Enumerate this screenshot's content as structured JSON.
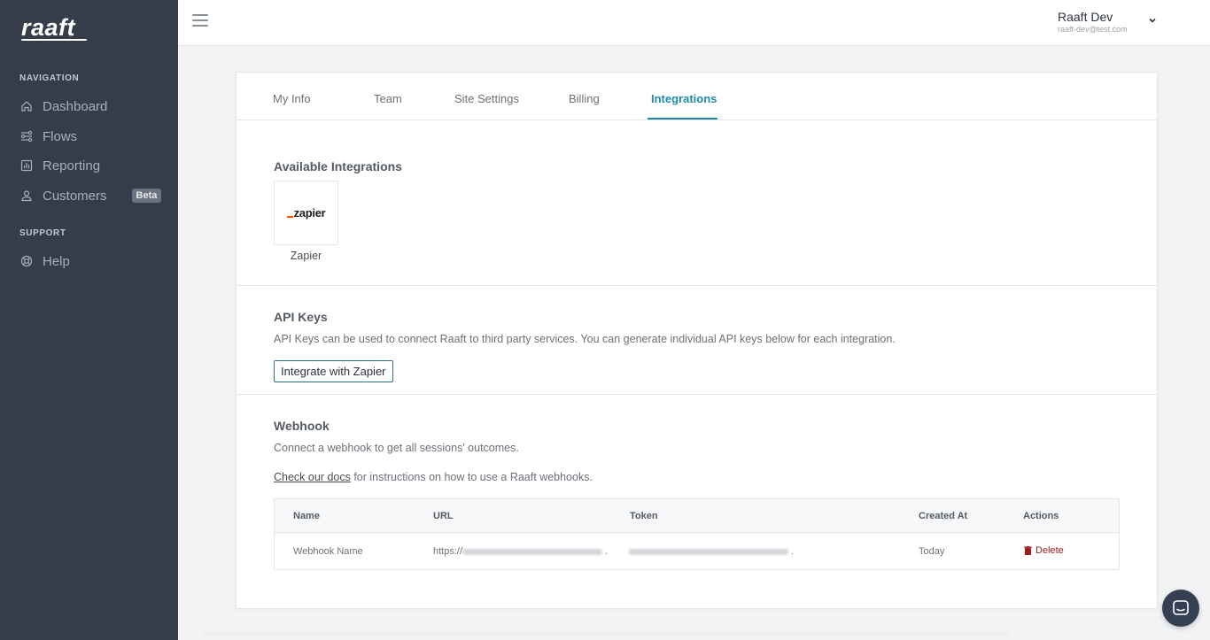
{
  "sidebar": {
    "logo": "raaft",
    "nav_heading": "NAVIGATION",
    "nav_items": [
      {
        "label": "Dashboard",
        "icon": "home-icon"
      },
      {
        "label": "Flows",
        "icon": "flows-icon"
      },
      {
        "label": "Reporting",
        "icon": "chart-icon"
      },
      {
        "label": "Customers",
        "icon": "user-icon",
        "badge": "Beta"
      }
    ],
    "support_heading": "SUPPORT",
    "support_items": [
      {
        "label": "Help",
        "icon": "lifebuoy-icon"
      }
    ]
  },
  "header": {
    "user_name": "Raaft Dev",
    "user_email": "raaft-dev@test.com"
  },
  "tabs": [
    "My Info",
    "Team",
    "Site Settings",
    "Billing",
    "Integrations"
  ],
  "active_tab": "Integrations",
  "integrations": {
    "title": "Available Integrations",
    "items": [
      {
        "name": "Zapier",
        "logo_text": "zapier"
      }
    ]
  },
  "api_keys": {
    "title": "API Keys",
    "description": "API Keys can be used to connect Raaft to third party services. You can generate individual API keys below for each integration.",
    "button_label": "Integrate with Zapier"
  },
  "webhook": {
    "title": "Webhook",
    "description": "Connect a webhook to get all sessions' outcomes.",
    "docs_link": "Check our docs",
    "docs_suffix": " for instructions on how to use a Raaft webhooks.",
    "columns": [
      "Name",
      "URL",
      "Token",
      "Created At",
      "Actions"
    ],
    "rows": [
      {
        "name": "Webhook Name",
        "url_prefix": "https://",
        "url_suffix": " .",
        "token_suffix": " .",
        "created_at": "Today",
        "action": "Delete"
      }
    ]
  },
  "colors": {
    "sidebar_bg": "#353d4a",
    "accent": "#2089a8",
    "danger": "#9b1c1c",
    "zapier_orange": "#ff4a00"
  }
}
